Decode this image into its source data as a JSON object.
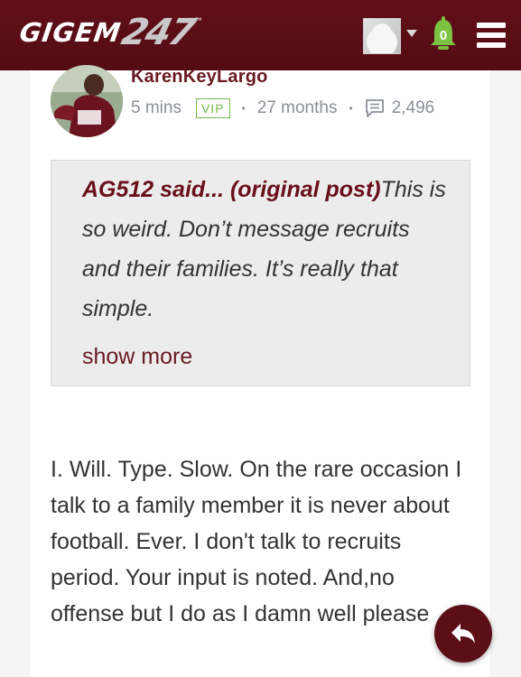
{
  "header": {
    "logo_text": "GIGEM",
    "logo_number": "247",
    "logo_tm": "™",
    "notification_count": "0",
    "brand_color": "#5a0e16",
    "bell_color": "#7cc242"
  },
  "post": {
    "username": "KarenKeyLargo",
    "time_ago": "5 mins",
    "badge": "VIP",
    "separator": "•",
    "membership": "27 months",
    "post_count": "2,496",
    "quote": {
      "author_label": "AG512 said... (original post)",
      "text": "This is so weird. Don’t message recruits and their families. It’s really that simple.",
      "show_more_label": "show more"
    },
    "body": "I. Will. Type. Slow. On the rare occasion I talk to a family member it is never about football. Ever. I don't talk to recruits period. Your input is noted. And,no offense but I do as I damn well please"
  },
  "icons": {
    "user_menu": "user-avatar-icon",
    "caret": "chevron-down-icon",
    "notifications": "bell-icon",
    "menu": "hamburger-menu-icon",
    "posts": "comment-icon",
    "reply": "reply-icon"
  }
}
